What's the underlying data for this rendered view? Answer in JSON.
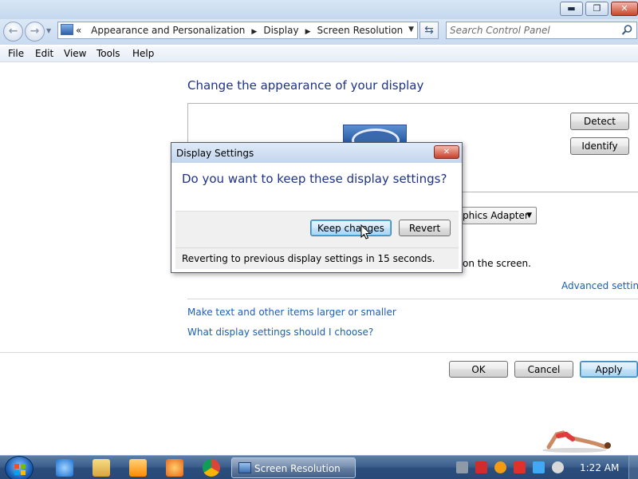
{
  "window": {
    "minimize_label": "▬",
    "maximize_label": "❐",
    "close_label": "✕"
  },
  "address_bar": {
    "overflow": "«",
    "breadcrumbs": [
      "Appearance and Personalization",
      "Display",
      "Screen Resolution"
    ]
  },
  "search": {
    "placeholder": "Search Control Panel"
  },
  "menu": [
    "File",
    "Edit",
    "View",
    "Tools",
    "Help"
  ],
  "content": {
    "heading": "Change the appearance of your display",
    "detect_label": "Detect",
    "identify_label": "Identify",
    "adapter_value": "phics Adapter",
    "on_screen_text": "on the screen.",
    "advanced_link": "Advanced settings",
    "link_text_size": "Make text and other items larger or smaller",
    "link_help": "What display settings should I choose?",
    "ok_label": "OK",
    "cancel_label": "Cancel",
    "apply_label": "Apply"
  },
  "dialog": {
    "title": "Display Settings",
    "close_label": "✕",
    "question": "Do you want to keep these display settings?",
    "keep_label": "Keep changes",
    "revert_label": "Revert",
    "status": "Reverting to previous display settings in 15 seconds."
  },
  "taskbar": {
    "active_task_label": "Screen Resolution",
    "clock": "1:22 AM",
    "pinned_icons": [
      "internet-explorer-icon",
      "folder-icon",
      "media-player-icon",
      "app-icon",
      "chrome-icon"
    ],
    "tray_icons": [
      "network-icon",
      "antivirus-icon",
      "search-tray-icon",
      "flag-icon",
      "display-tray-icon",
      "volume-icon"
    ]
  },
  "colors": {
    "heading": "#1e3287",
    "link": "#1a5fb4",
    "taskbar": "#3c5f8e"
  }
}
